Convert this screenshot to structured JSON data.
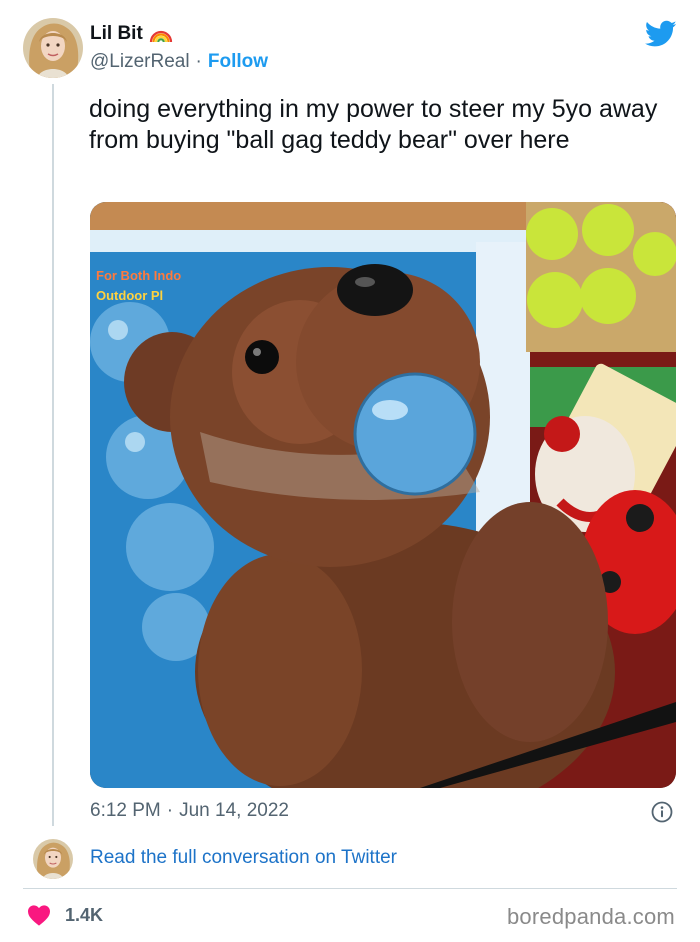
{
  "tweet": {
    "author": {
      "name": "Lil Bit",
      "emoji_icon": "rainbow-icon",
      "handle": "@LizerReal",
      "separator": "·",
      "follow_label": "Follow"
    },
    "text": "doing everything in my power to steer my 5yo away from buying \"ball gag teddy bear\" over here",
    "image": {
      "package_text": "For Both Indo",
      "package_text_2": "Outdoor Pl"
    },
    "timestamp": {
      "time": "6:12 PM",
      "separator": "·",
      "date": "Jun 14, 2022"
    },
    "read_full_label": "Read the full conversation on Twitter",
    "likes": "1.4K"
  },
  "watermark": "boredpanda.com",
  "colors": {
    "brand_blue": "#1d9bf0",
    "link_blue": "#1d73c8",
    "heart_pink": "#f91880",
    "muted_text": "#536471"
  }
}
